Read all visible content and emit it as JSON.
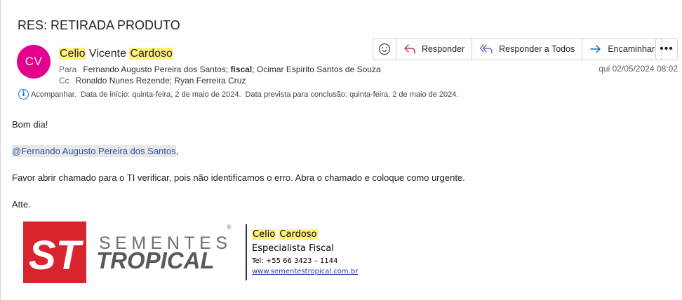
{
  "subject": "RES: RETIRADA PRODUTO",
  "avatar_initials": "CV",
  "avatar_color": "#e3008c",
  "sender": {
    "first": "Celio",
    "middle": " Vicente ",
    "last": "Cardoso"
  },
  "recipients": {
    "to_label": "Para",
    "to_part1": "Fernando Augusto Pereira dos Santos; ",
    "to_bold": "fiscal",
    "to_part2": "; Ocimar Espirito Santos de Souza",
    "cc_label": "Cc",
    "cc": "Ronaldo Nunes Rezende; Ryan Ferreira Cruz"
  },
  "info_bar": {
    "follow": "Acompanhar.",
    "start": "Data de início: quinta-feira, 2 de maio de 2024.",
    "due": "Data prevista para conclusão: quinta-feira, 2 de maio de 2024."
  },
  "actions": {
    "reply": "Responder",
    "reply_all": "Responder a Todos",
    "forward": "Encaminhar"
  },
  "received": "qui 02/05/2024 08:02",
  "body": {
    "greeting": "Bom dia!",
    "mention": "@Fernando Augusto Pereira dos Santos",
    "mention_tail": ",",
    "message": "Favor abrir chamado para o TI verificar, pois não identificamos o erro. Abra o chamado e coloque como urgente.",
    "closing": "Atte."
  },
  "signature": {
    "logo_mark": "ST",
    "logo_top": "SEMENTES",
    "logo_bottom": "TROPICAL",
    "logo_reg": "®",
    "name_first": "Celio",
    "name_last": "Cardoso",
    "role": "Especialista Fiscal",
    "tel": "Tel: +55 66 3423 – 1144",
    "website": "www.sementestropical.com.br"
  },
  "colors": {
    "accent": "#0f6cbd",
    "reply_icon": "#c4314b",
    "reply_all_icon": "#8764b8",
    "forward_icon": "#0f6cbd",
    "logo_red": "#d9232d",
    "highlight": "#fff17a"
  }
}
